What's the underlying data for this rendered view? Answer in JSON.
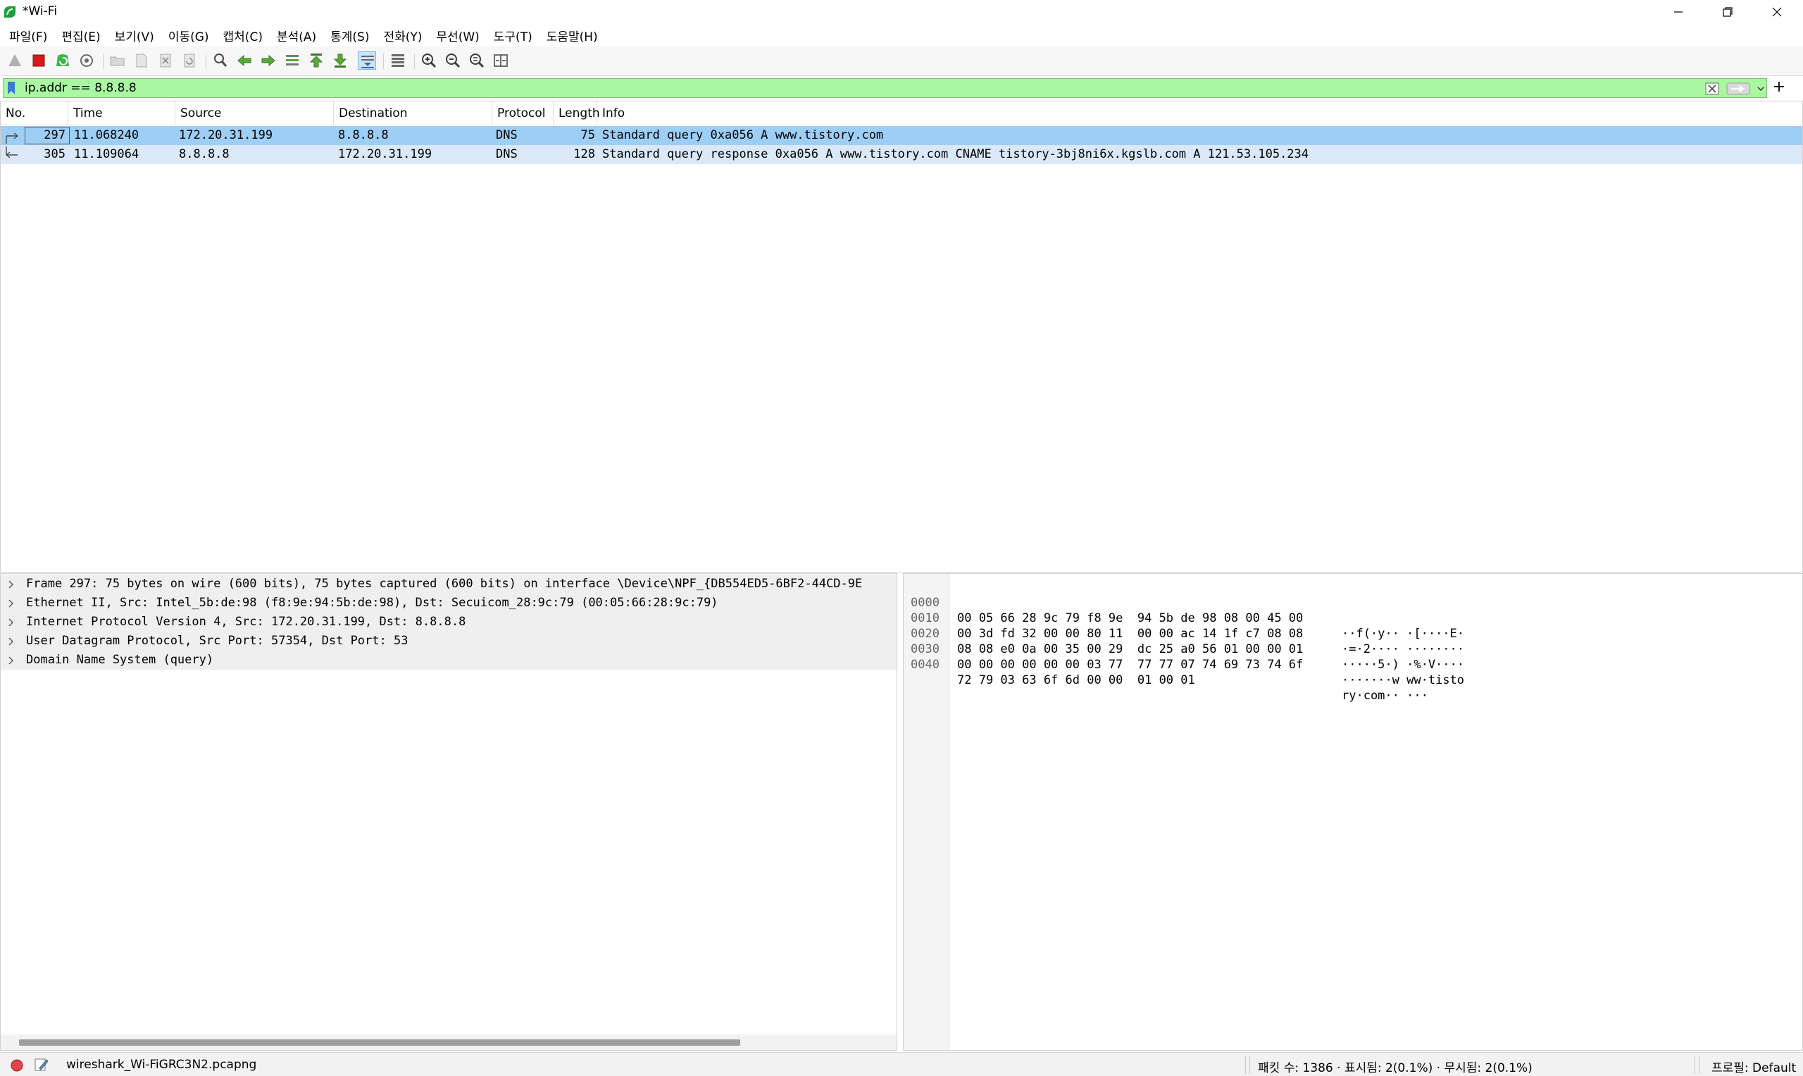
{
  "window": {
    "title": "*Wi-Fi"
  },
  "menu": [
    "파일(F)",
    "편집(E)",
    "보기(V)",
    "이동(G)",
    "캡처(C)",
    "분석(A)",
    "통계(S)",
    "전화(Y)",
    "무선(W)",
    "도구(T)",
    "도움말(H)"
  ],
  "toolbar": {
    "icons": [
      "start-capture-icon",
      "stop-capture-icon",
      "restart-capture-icon",
      "capture-options-icon",
      "open-file-icon",
      "save-file-icon",
      "close-file-icon",
      "reload-file-icon",
      "find-packet-icon",
      "go-back-icon",
      "go-forward-icon",
      "go-to-packet-icon",
      "go-first-icon",
      "go-last-icon",
      "auto-scroll-icon",
      "colorize-icon",
      "zoom-in-icon",
      "zoom-out-icon",
      "normal-size-icon",
      "resize-columns-icon"
    ]
  },
  "filter": {
    "value": "ip.addr == 8.8.8.8",
    "color": "#a9f7a0",
    "add_label": "+"
  },
  "packet_list": {
    "columns": [
      "No.",
      "Time",
      "Source",
      "Destination",
      "Protocol",
      "Length",
      "Info"
    ],
    "rows": [
      {
        "no": "297",
        "time": "11.068240",
        "source": "172.20.31.199",
        "destination": "8.8.8.8",
        "protocol": "DNS",
        "length": "75",
        "info": "Standard query 0xa056 A www.tistory.com",
        "selected": true
      },
      {
        "no": "305",
        "time": "11.109064",
        "source": "8.8.8.8",
        "destination": "172.20.31.199",
        "protocol": "DNS",
        "length": "128",
        "info": "Standard query response 0xa056 A www.tistory.com CNAME tistory-3bj8ni6x.kgslb.com A 121.53.105.234",
        "selected": false
      }
    ],
    "selected_color": "#9dcef6",
    "row_color": "#dae8f7"
  },
  "details": {
    "items": [
      "Frame 297: 75 bytes on wire (600 bits), 75 bytes captured (600 bits) on interface \\Device\\NPF_{DB554ED5-6BF2-44CD-9E",
      "Ethernet II, Src: Intel_5b:de:98 (f8:9e:94:5b:de:98), Dst: Secuicom_28:9c:79 (00:05:66:28:9c:79)",
      "Internet Protocol Version 4, Src: 172.20.31.199, Dst: 8.8.8.8",
      "User Datagram Protocol, Src Port: 57354, Dst Port: 53",
      "Domain Name System (query)"
    ]
  },
  "bytes": {
    "rows": [
      {
        "offset": "0000",
        "hex": "00 05 66 28 9c 79 f8 9e  94 5b de 98 08 00 45 00",
        "ascii": "··f(·y·· ·[····E·"
      },
      {
        "offset": "0010",
        "hex": "00 3d fd 32 00 00 80 11  00 00 ac 14 1f c7 08 08",
        "ascii": "·=·2···· ········"
      },
      {
        "offset": "0020",
        "hex": "08 08 e0 0a 00 35 00 29  dc 25 a0 56 01 00 00 01",
        "ascii": "·····5·) ·%·V····"
      },
      {
        "offset": "0030",
        "hex": "00 00 00 00 00 00 03 77  77 77 07 74 69 73 74 6f",
        "ascii": "·······w ww·tisto"
      },
      {
        "offset": "0040",
        "hex": "72 79 03 63 6f 6d 00 00  01 00 01",
        "ascii": "ry·com·· ···"
      }
    ]
  },
  "status": {
    "file": "wireshark_Wi-FiGRC3N2.pcapng",
    "counts": "패킷 수: 1386 · 표시됨: 2(0.1%) · 무시됨: 2(0.1%)",
    "profile": "프로필: Default"
  }
}
